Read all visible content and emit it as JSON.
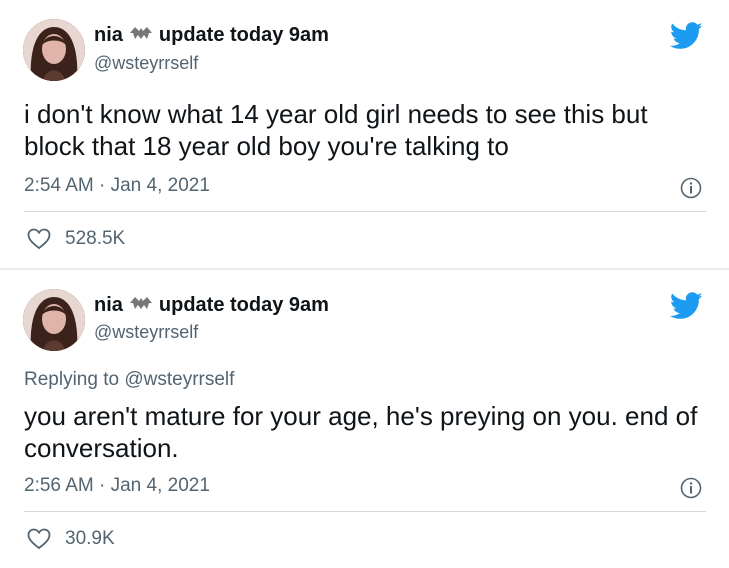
{
  "tweets": [
    {
      "display_name": "nia",
      "name_suffix": "update today 9am",
      "handle": "@wsteyrrself",
      "text": "i don't know what 14 year old girl needs to see this but block that 18 year old boy you're talking to",
      "timestamp": "2:54 AM · Jan 4, 2021",
      "likes": "528.5K"
    },
    {
      "display_name": "nia",
      "name_suffix": "update today 9am",
      "handle": "@wsteyrrself",
      "replying_label": "Replying to",
      "replying_to": "@wsteyrrself",
      "text": "you aren't mature for your age, he's preying on you. end of conversation.",
      "timestamp": "2:56 AM · Jan 4, 2021",
      "likes": "30.9K"
    }
  ],
  "icons": {
    "brand": "twitter-bird-icon",
    "name_emoji": "bat-emoji-icon",
    "info": "info-icon",
    "like": "heart-icon"
  },
  "colors": {
    "twitter_blue": "#1d9bf0",
    "secondary_text": "#536471",
    "divider": "#cfd9de"
  }
}
